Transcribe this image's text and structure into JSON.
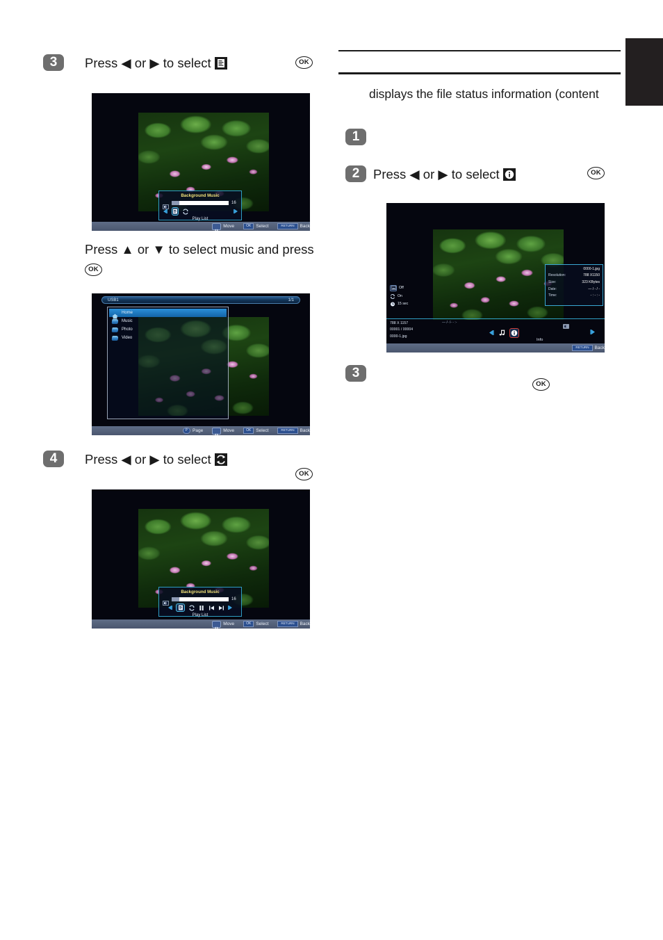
{
  "document": {
    "side_tab": "",
    "left_column": {
      "steps": [
        {
          "number": "3",
          "text_before": "Press ◀ or ▶ to select",
          "icon": "playlist-icon",
          "ok_badge": "OK"
        },
        {
          "number": "4",
          "text_before": "Press ◀ or ▶ to select",
          "icon": "repeat-icon",
          "ok_badge": "OK"
        }
      ],
      "sub_instruction": {
        "line1": "Press ▲ or ▼ to select music and press",
        "ok_badge": "OK"
      }
    },
    "right_column": {
      "paragraph": "displays the file status information (content",
      "steps": [
        {
          "number": "1",
          "text_before": "",
          "icon": "",
          "ok_badge": ""
        },
        {
          "number": "2",
          "text_before": "Press ◀ or ▶ to select",
          "icon": "info-icon",
          "ok_badge": "OK"
        },
        {
          "number": "3",
          "text_before": "",
          "icon": "",
          "ok_badge": "OK"
        }
      ]
    }
  },
  "screens": {
    "bgm_basic": {
      "panel_title": "Background Music",
      "volume_value": "16",
      "volume_percent": 14,
      "playlist_label": "Play List",
      "controls": [
        "prev-arrow-icon",
        "playlist-icon",
        "repeat-icon",
        "next-arrow-icon"
      ],
      "selected_control": "playlist-icon",
      "bottom_bar": [
        {
          "key": "dpad",
          "label": "Move"
        },
        {
          "key": "OK",
          "label": "Select"
        },
        {
          "key": "RETURN",
          "label": "Back"
        }
      ]
    },
    "usb_browser": {
      "header_title": "USB1",
      "header_page": "1/1",
      "items": [
        {
          "label": "Home",
          "icon": "home-icon",
          "selected": true
        },
        {
          "label": "Music",
          "icon": "folder-icon",
          "selected": false
        },
        {
          "label": "Photo",
          "icon": "folder-icon",
          "selected": false
        },
        {
          "label": "Video",
          "icon": "folder-icon",
          "selected": false
        }
      ],
      "bottom_bar": [
        {
          "key": "P",
          "label": "Page"
        },
        {
          "key": "dpad",
          "label": "Move"
        },
        {
          "key": "OK",
          "label": "Select"
        },
        {
          "key": "RETURN",
          "label": "Back"
        }
      ]
    },
    "bgm_full": {
      "panel_title": "Background Music",
      "volume_value": "16",
      "volume_percent": 14,
      "playlist_label": "Play List",
      "controls": [
        "prev-arrow-icon",
        "playlist-icon",
        "repeat-icon",
        "pause-icon",
        "skip-back-icon",
        "skip-forward-icon",
        "next-arrow-icon"
      ],
      "selected_control": "playlist-icon",
      "bottom_bar": [
        {
          "key": "dpad",
          "label": "Move"
        },
        {
          "key": "OK",
          "label": "Select"
        },
        {
          "key": "RETURN",
          "label": "Back"
        }
      ]
    },
    "file_info": {
      "info_panel": {
        "filename": "0000-1.jpg",
        "rows": [
          {
            "key": "Resolution:",
            "value": "788 X1150"
          },
          {
            "key": "Size:",
            "value": "323 KBytes"
          },
          {
            "key": "Date:",
            "value": "— / - / -"
          },
          {
            "key": "Time:",
            "value": "- : - : -"
          }
        ]
      },
      "status_items": [
        {
          "icon": "image-icon",
          "label": "Off"
        },
        {
          "icon": "repeat-icon",
          "label": "On"
        },
        {
          "icon": "clock-icon",
          "label": "15 sec"
        }
      ],
      "meta_lines": [
        "788 X 1157",
        "00001 / 00004",
        "0000-1.jpg"
      ],
      "timecode": "— /- /-   - :-",
      "center_controls": [
        "prev-arrow-icon",
        "music-note-icon",
        "info-icon"
      ],
      "selected_control": "info-icon",
      "next_control": "next-arrow-icon",
      "center_label": "Info",
      "bottom_bar": [
        {
          "key": "RETURN",
          "label": "Back"
        }
      ]
    }
  }
}
